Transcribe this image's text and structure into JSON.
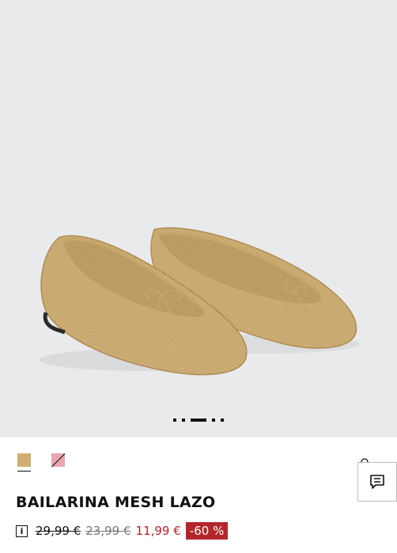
{
  "gallery": {
    "image_alt": "Bailarina mesh lazo dorada",
    "slide_count": 5,
    "active_slide": 3
  },
  "swatches": [
    {
      "color": "#cfad74",
      "name": "gold",
      "selected": true
    },
    {
      "color": "#e7a6b0",
      "name": "pink",
      "unavailable": true
    }
  ],
  "product": {
    "title": "BAILARINA MESH LAZO",
    "price_original": "29,99 €",
    "price_previous": "23,99 €",
    "price_current": "11,99 €",
    "discount": "-60 %"
  },
  "colors": {
    "sale": "#b3262b",
    "background_image": "#e9eaec"
  },
  "icons": {
    "info": "info-icon",
    "chat": "chat-icon"
  }
}
